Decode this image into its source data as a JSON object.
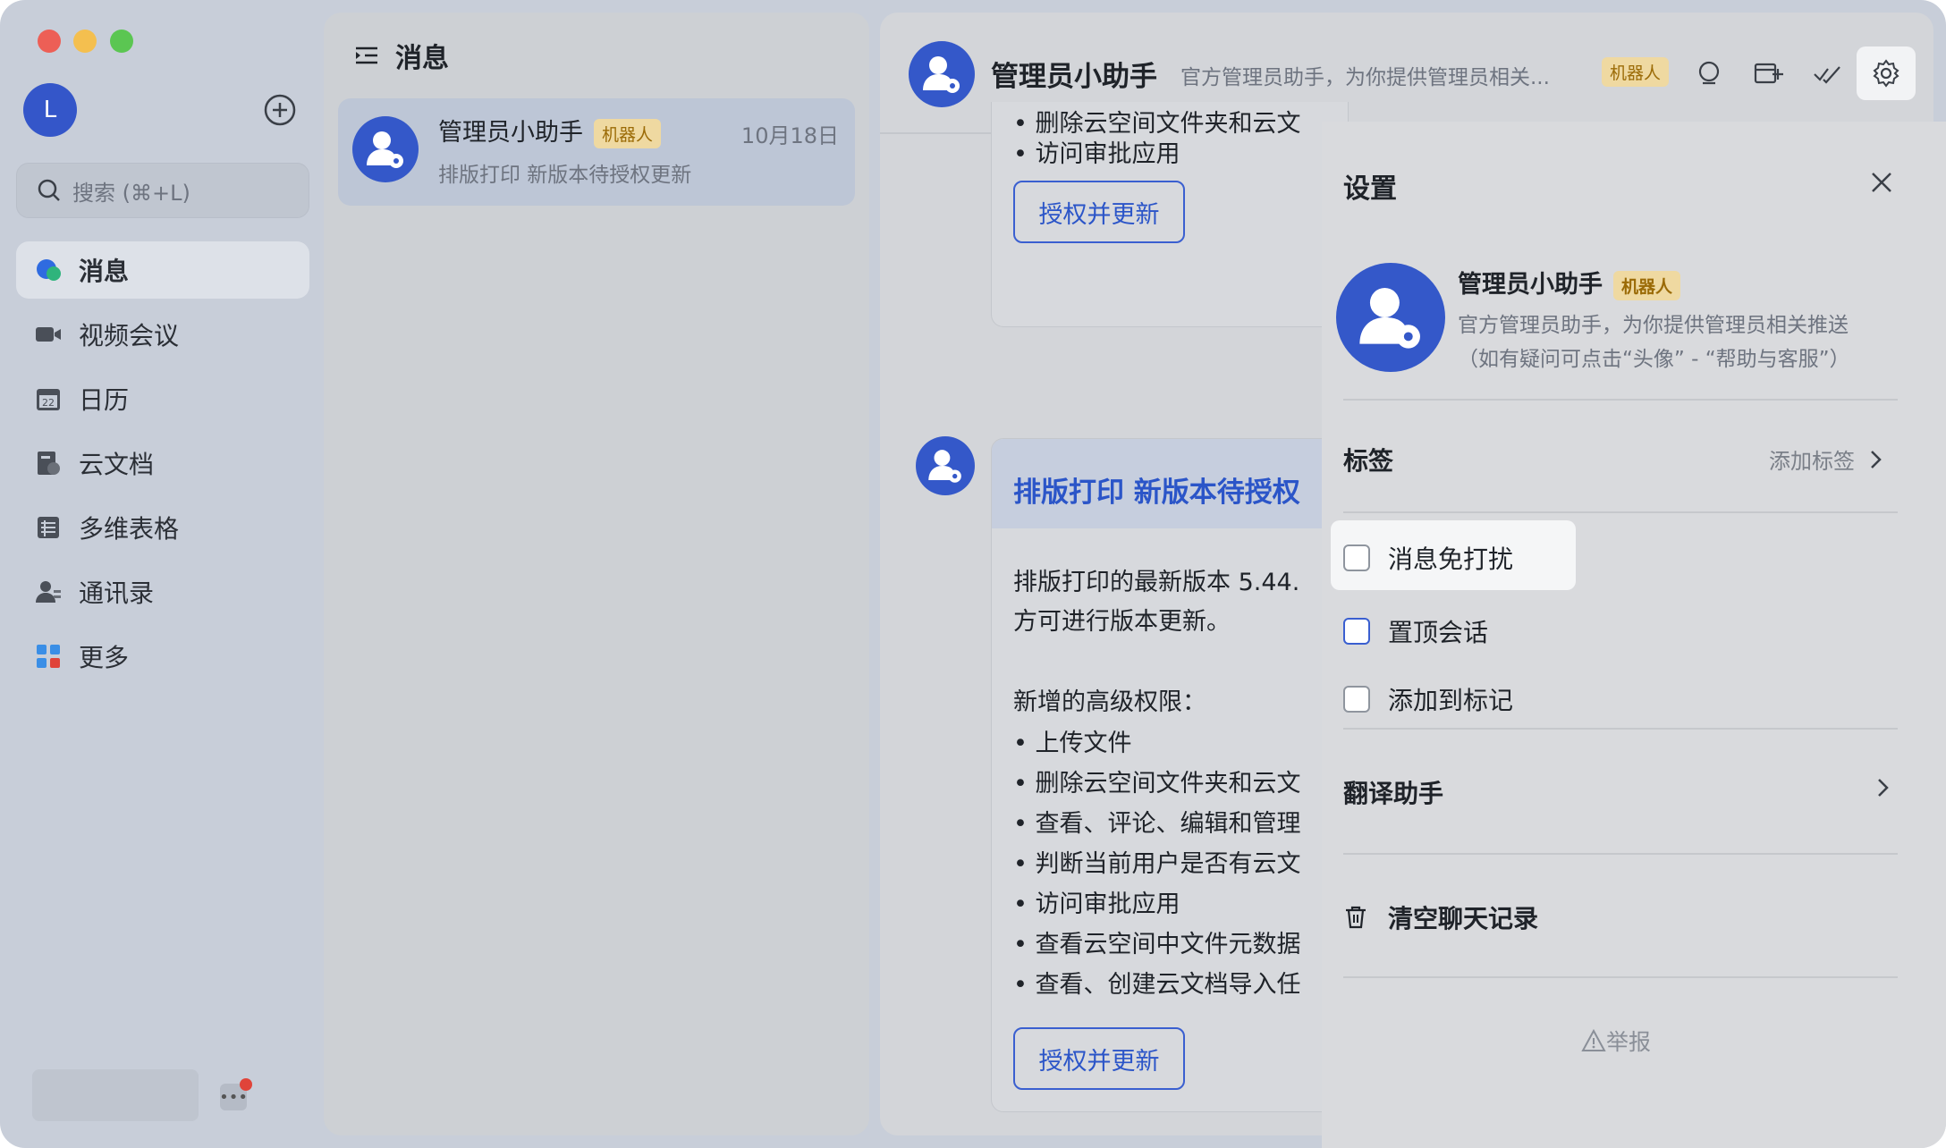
{
  "window": {
    "traffic_lights": [
      "close",
      "minimize",
      "zoom"
    ]
  },
  "sidebar": {
    "avatar_letter": "L",
    "search_placeholder": "搜索 (⌘+L)",
    "items": [
      {
        "label": "消息",
        "icon": "chat-bubble-icon",
        "active": true
      },
      {
        "label": "视频会议",
        "icon": "video-camera-icon"
      },
      {
        "label": "日历",
        "icon": "calendar-icon",
        "icon_text": "22"
      },
      {
        "label": "云文档",
        "icon": "cloud-doc-icon"
      },
      {
        "label": "多维表格",
        "icon": "table-icon"
      },
      {
        "label": "通讯录",
        "icon": "contacts-icon"
      },
      {
        "label": "更多",
        "icon": "apps-grid-icon"
      }
    ]
  },
  "list": {
    "title": "消息",
    "conversation": {
      "name": "管理员小助手",
      "tag": "机器人",
      "date": "10月18日",
      "preview": "排版打印 新版本待授权更新"
    }
  },
  "chat": {
    "header": {
      "name": "管理员小助手",
      "desc": "官方管理员助手，为你提供管理员相关...",
      "tag": "机器人"
    },
    "card1": {
      "lines": [
        "• 删除云空间文件夹和云文",
        "• 访问审批应用"
      ],
      "button": "授权并更新"
    },
    "card2": {
      "title": "排版打印 新版本待授权",
      "intro1": "排版打印的最新版本 5.44.",
      "intro2": "方可进行版本更新。",
      "perm_title": "新增的高级权限：",
      "items": [
        "• 上传文件",
        "• 删除云空间文件夹和云文",
        "• 查看、评论、编辑和管理",
        "• 判断当前用户是否有云文",
        "• 访问审批应用",
        "• 查看云空间中文件元数据",
        "• 查看、创建云文档导入任"
      ],
      "button": "授权并更新"
    }
  },
  "settings": {
    "title": "设置",
    "bot": {
      "name": "管理员小助手",
      "tag": "机器人",
      "desc1": "官方管理员助手，为你提供管理员相关推送",
      "desc2": "（如有疑问可点击“头像” - “帮助与客服”）"
    },
    "tags_label": "标签",
    "tags_action": "添加标签",
    "checkboxes": [
      "消息免打扰",
      "置顶会话",
      "添加到标记"
    ],
    "translate": "翻译助手",
    "clear": "清空聊天记录",
    "report": "举报"
  },
  "colors": {
    "accent": "#3458c9",
    "bot_tag_bg": "#efd9a1",
    "bot_tag_text": "#9b6b07",
    "red_dot": "#e0443a"
  }
}
